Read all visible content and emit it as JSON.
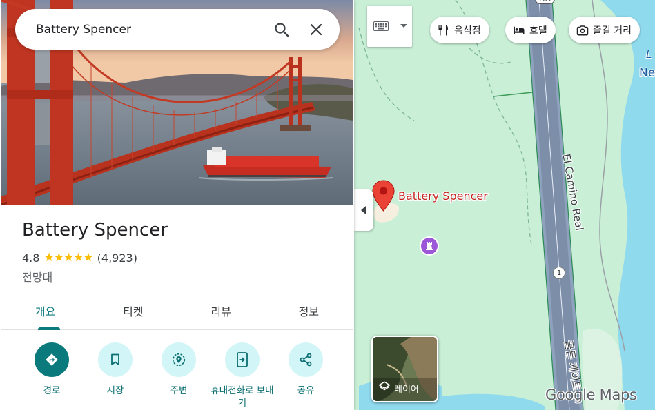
{
  "search": {
    "query": "Battery Spencer"
  },
  "place": {
    "name": "Battery Spencer",
    "rating": "4.8",
    "stars": "★★★★★",
    "review_count": "(4,923)",
    "category": "전망대"
  },
  "tabs": [
    {
      "label": "개요",
      "active": true
    },
    {
      "label": "티켓"
    },
    {
      "label": "리뷰"
    },
    {
      "label": "정보"
    }
  ],
  "actions": [
    {
      "label": "경로",
      "icon": "directions-icon"
    },
    {
      "label": "저장",
      "icon": "bookmark-icon"
    },
    {
      "label": "주변",
      "icon": "nearby-icon"
    },
    {
      "label": "휴대전화로 보내기",
      "icon": "send-to-phone-icon"
    },
    {
      "label": "공유",
      "icon": "share-icon"
    }
  ],
  "map": {
    "chips": [
      {
        "label": "음식점",
        "icon": "restaurant-icon"
      },
      {
        "label": "호텔",
        "icon": "hotel-icon"
      },
      {
        "label": "즐길 거리",
        "icon": "camera-icon"
      }
    ],
    "pin_label": "Battery Spencer",
    "roads": {
      "el_camino": "El Camino Real",
      "golden_gate": "골든 게이트",
      "route_1": "1",
      "top_shield": "101"
    },
    "edge_text": "Ne",
    "edge_text2": "L",
    "layer_label": "레이어",
    "logo": "Google Maps"
  },
  "colors": {
    "accent": "#0b7a7d",
    "pin": "#ea4335",
    "land": "#c9efd7",
    "water": "#90daee",
    "star": "#fbbc04"
  }
}
